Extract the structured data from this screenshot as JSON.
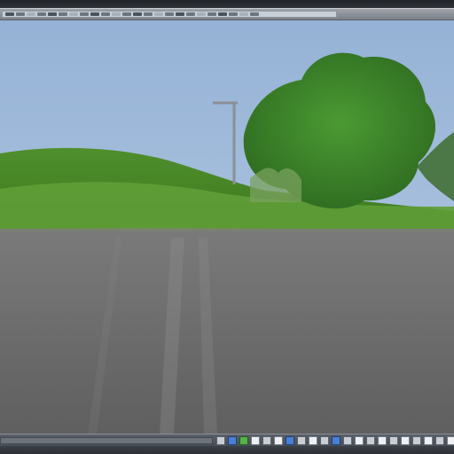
{
  "app": {
    "title": ""
  },
  "toolbar": {
    "items": [
      {
        "icon": "toolbar-segment-1"
      },
      {
        "icon": "toolbar-segment-2"
      },
      {
        "icon": "toolbar-segment-3"
      },
      {
        "icon": "toolbar-segment-4"
      },
      {
        "icon": "toolbar-segment-5"
      },
      {
        "icon": "toolbar-segment-6"
      },
      {
        "icon": "toolbar-segment-7"
      },
      {
        "icon": "toolbar-segment-8"
      },
      {
        "icon": "toolbar-segment-9"
      },
      {
        "icon": "toolbar-segment-10"
      },
      {
        "icon": "toolbar-segment-11"
      },
      {
        "icon": "toolbar-segment-12"
      },
      {
        "icon": "toolbar-segment-13"
      },
      {
        "icon": "toolbar-segment-14"
      },
      {
        "icon": "toolbar-segment-15"
      },
      {
        "icon": "toolbar-segment-16"
      },
      {
        "icon": "toolbar-segment-17"
      },
      {
        "icon": "toolbar-segment-18"
      },
      {
        "icon": "toolbar-segment-19"
      },
      {
        "icon": "toolbar-segment-20"
      },
      {
        "icon": "toolbar-segment-21"
      },
      {
        "icon": "toolbar-segment-22"
      },
      {
        "icon": "toolbar-segment-23"
      },
      {
        "icon": "toolbar-segment-24"
      }
    ]
  },
  "viewport": {
    "scene": {
      "sky_color": "#8fb0d6",
      "grass_color": "#4f8f2c",
      "road_color": "#6a6a6a",
      "tree_color": "#3f7f2f"
    }
  },
  "bottom_toolbar": {
    "icons": [
      {
        "name": "select-icon",
        "style": "gray"
      },
      {
        "name": "camera-icon",
        "style": "blue"
      },
      {
        "name": "scene-icon",
        "style": "green"
      },
      {
        "name": "move-icon",
        "style": "white"
      },
      {
        "name": "object-icon",
        "style": "gray"
      },
      {
        "name": "layer-icon",
        "style": "white"
      },
      {
        "name": "render-icon",
        "style": "blue"
      },
      {
        "name": "light-icon",
        "style": "gray"
      },
      {
        "name": "material-icon",
        "style": "white"
      },
      {
        "name": "zoom-in-icon",
        "style": "gray"
      },
      {
        "name": "zoom-out-icon",
        "style": "blue"
      },
      {
        "name": "pan-icon",
        "style": "gray"
      },
      {
        "name": "orbit-icon",
        "style": "white"
      },
      {
        "name": "frame-icon",
        "style": "gray"
      },
      {
        "name": "grid-icon",
        "style": "white"
      },
      {
        "name": "snap-icon",
        "style": "gray"
      },
      {
        "name": "measure-icon",
        "style": "white"
      },
      {
        "name": "timeline-icon",
        "style": "gray"
      },
      {
        "name": "play-icon",
        "style": "white"
      },
      {
        "name": "stop-icon",
        "style": "gray"
      },
      {
        "name": "settings-icon",
        "style": "white"
      }
    ]
  }
}
